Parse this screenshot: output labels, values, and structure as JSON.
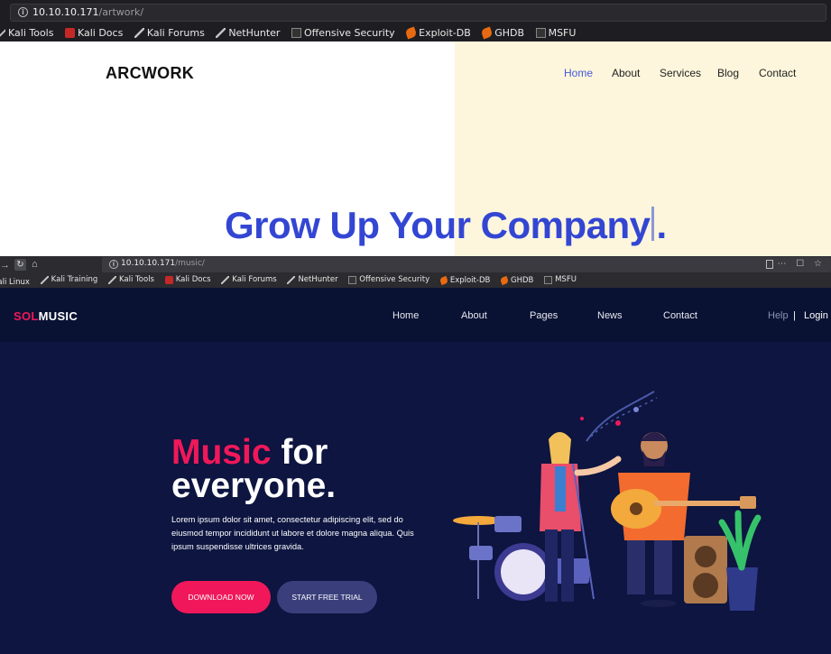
{
  "top_browser": {
    "url_host": "10.10.10.171",
    "url_path": "/artwork/",
    "bookmarks": [
      "Kali Tools",
      "Kali Docs",
      "Kali Forums",
      "NetHunter",
      "Offensive Security",
      "Exploit-DB",
      "GHDB",
      "MSFU"
    ]
  },
  "artwork": {
    "logo": "ARCWORK",
    "nav": [
      "Home",
      "About",
      "Services",
      "Blog",
      "Contact"
    ],
    "hero_main": "Grow Up Your Company",
    "hero_end": "."
  },
  "bottom_browser": {
    "url_host": "10.10.10.171",
    "url_path": "/music/",
    "bookmarks": [
      "Kali Linux",
      "Kali Training",
      "Kali Tools",
      "Kali Docs",
      "Kali Forums",
      "NetHunter",
      "Offensive Security",
      "Exploit-DB",
      "GHDB",
      "MSFU"
    ]
  },
  "music": {
    "logo_sol": "SOL",
    "logo_music": "MUSIC",
    "nav": [
      "Home",
      "About",
      "Pages",
      "News",
      "Contact"
    ],
    "help": "Help",
    "separator": "|",
    "login": "Login",
    "hero_pink": "Music",
    "hero_rest1": " for",
    "hero_rest2": "everyone.",
    "description": "Lorem ipsum dolor sit amet, consectetur adipiscing elit, sed do eiusmod tempor incididunt ut labore et dolore magna aliqua. Quis ipsum suspendisse ultrices gravida.",
    "btn_download": "DOWNLOAD NOW",
    "btn_trial": "START FREE TRIAL"
  },
  "colors": {
    "art_accent": "#3346d3",
    "art_panel": "#fdf6dc",
    "music_bg": "#0d1540",
    "music_pink": "#f0185a",
    "trial_btn": "#3a3f7c"
  }
}
